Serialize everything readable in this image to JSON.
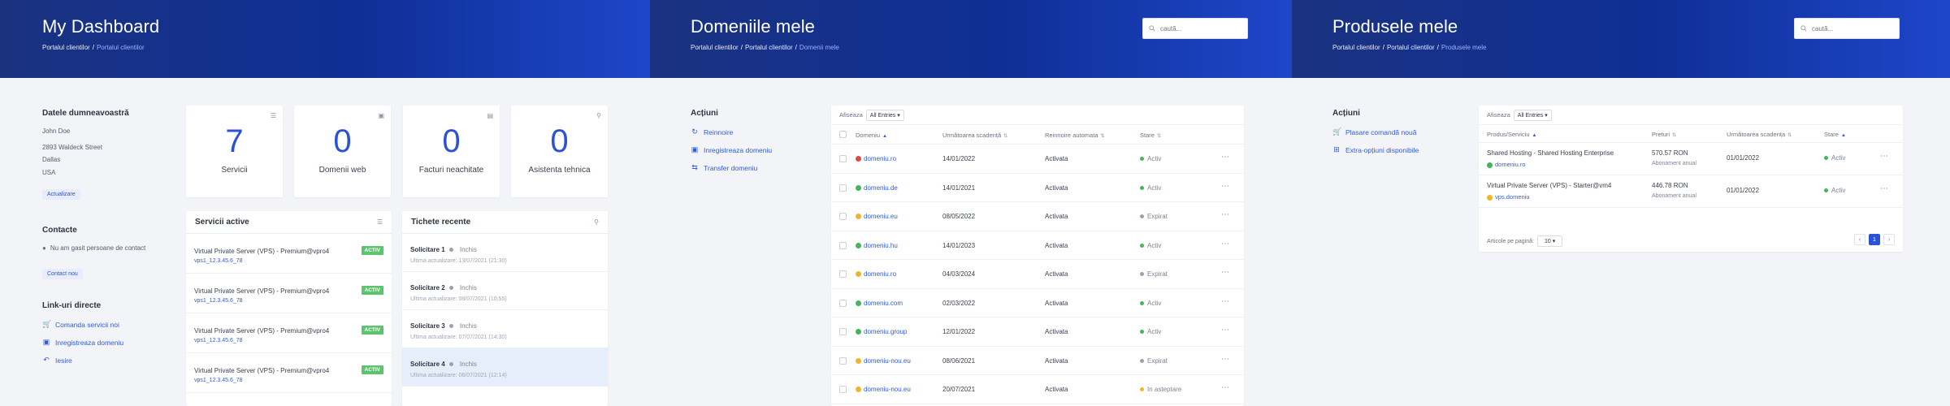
{
  "dashboard": {
    "title": "My Dashboard",
    "breadcrumb": [
      "Portalul clientilor",
      "Portalul clientilor"
    ],
    "details": {
      "heading": "Datele dumneavoastră",
      "name": "John Doe",
      "address": [
        "2893 Waldeck Street",
        "Dallas",
        "USA"
      ],
      "update_label": "Actualizare"
    },
    "contacts": {
      "heading": "Contacte",
      "empty_text": "Nu am gasit persoane de contact",
      "new_label": "Contact nou"
    },
    "links": {
      "heading": "Link-uri directe",
      "items": [
        "Comanda servicii noi",
        "Inregistreaza domeniu",
        "Iesire"
      ]
    },
    "stats": [
      {
        "value": "7",
        "label": "Servicii"
      },
      {
        "value": "0",
        "label": "Domenii web"
      },
      {
        "value": "0",
        "label": "Facturi neachitate"
      },
      {
        "value": "0",
        "label": "Asistenta tehnica"
      }
    ],
    "services": {
      "heading": "Servicii active",
      "items": [
        {
          "name": "Virtual Private Server (VPS) - Premium@vpro4",
          "host": "vps1_12.3.45.6_78",
          "status": "ACTIV"
        },
        {
          "name": "Virtual Private Server (VPS) - Premium@vpro4",
          "host": "vps1_12.3.45.6_78",
          "status": "ACTIV"
        },
        {
          "name": "Virtual Private Server (VPS) - Premium@vpro4",
          "host": "vps1_12.3.45.6_78",
          "status": "ACTIV"
        },
        {
          "name": "Virtual Private Server (VPS) - Premium@vpro4",
          "host": "vps1_12.3.45.6_78",
          "status": "ACTIV"
        }
      ]
    },
    "tickets": {
      "heading": "Tichete recente",
      "items": [
        {
          "title": "Solicitare 1",
          "status": "Inchis",
          "updated": "Ultima actualizare: 13/07/2021 (21:30)"
        },
        {
          "title": "Solicitare 2",
          "status": "Inchis",
          "updated": "Ultima actualizare: 08/07/2021 (10:55)"
        },
        {
          "title": "Solicitare 3",
          "status": "Inchis",
          "updated": "Ultima actualizare: 07/07/2021 (14:30)"
        },
        {
          "title": "Solicitare 4",
          "status": "Inchis",
          "updated": "Ultima actualizare: 06/07/2021 (12:14)"
        }
      ]
    }
  },
  "domains": {
    "title": "Domeniile mele",
    "breadcrumb": [
      "Portalul clientilor",
      "Portalul clientilor",
      "Domenii mele"
    ],
    "search_placeholder": "cautã...",
    "actions": {
      "heading": "Acțiuni",
      "items": [
        "Reinnoire",
        "Inregistreaza domeniu",
        "Transfer domeniu"
      ]
    },
    "table": {
      "show_label": "Afiseaza",
      "entries_label": "All Entries",
      "headers": [
        "Domeniu",
        "Urmãtoarea scadențã",
        "Reinnoire automata",
        "Stare"
      ],
      "rows": [
        {
          "domain": "domeniu.ro",
          "date": "14/01/2022",
          "renew": "Activata",
          "status": "Activ",
          "lock": "red"
        },
        {
          "domain": "domeniu.de",
          "date": "14/01/2021",
          "renew": "Activata",
          "status": "Activ",
          "lock": "green"
        },
        {
          "domain": "domeniu.eu",
          "date": "08/05/2022",
          "renew": "Activata",
          "status": "Expirat",
          "lock": "yellow"
        },
        {
          "domain": "domeniu.hu",
          "date": "14/01/2023",
          "renew": "Activata",
          "status": "Activ",
          "lock": "green"
        },
        {
          "domain": "domeniu.ro",
          "date": "04/03/2024",
          "renew": "Activata",
          "status": "Expirat",
          "lock": "yellow"
        },
        {
          "domain": "domeniu.com",
          "date": "02/03/2022",
          "renew": "Activata",
          "status": "Activ",
          "lock": "green"
        },
        {
          "domain": "domeniu.group",
          "date": "12/01/2022",
          "renew": "Activata",
          "status": "Activ",
          "lock": "green"
        },
        {
          "domain": "domeniu-nou.eu",
          "date": "08/06/2021",
          "renew": "Activata",
          "status": "Expirat",
          "lock": "yellow"
        },
        {
          "domain": "domeniu-nou.eu",
          "date": "20/07/2021",
          "renew": "Activata",
          "status": "In asteptare",
          "lock": "yellow"
        }
      ]
    }
  },
  "products": {
    "title": "Produsele mele",
    "breadcrumb": [
      "Portalul clientilor",
      "Portalul clientilor",
      "Produsele mele"
    ],
    "search_placeholder": "cautã...",
    "actions": {
      "heading": "Acțiuni",
      "items": [
        "Plasare comandã nouã",
        "Extra-opțiuni disponibile"
      ]
    },
    "table": {
      "show_label": "Afiseaza",
      "entries_label": "All Entries",
      "headers": [
        "Produs/Serviciu",
        "Preturi",
        "Urmãtoarea scadența",
        "Stare"
      ],
      "rows": [
        {
          "name": "Shared Hosting - Shared Hosting Enterprise",
          "domain": "domeniu.ro",
          "price": "570.57 RON",
          "cycle": "Abonament anual",
          "date": "01/01/2022",
          "status": "Activ"
        },
        {
          "name": "Virtual Private Server (VPS) - Starter@vm4",
          "domain": "vps.domeniu",
          "price": "446.78 RON",
          "cycle": "Abonament anual",
          "date": "01/01/2022",
          "status": "Activ"
        }
      ],
      "per_page_label": "Articole pe paginã:",
      "per_page_value": "10",
      "current_page": "1"
    }
  },
  "colors": {
    "accent": "#2b52d6",
    "active_badge": "#5cc46f",
    "status_active": "#43b55b",
    "status_expired": "#9aa1ad",
    "status_pending": "#f0b428",
    "lock_red": "#e04848",
    "lock_green": "#43b55b",
    "lock_yellow": "#f0b428"
  }
}
